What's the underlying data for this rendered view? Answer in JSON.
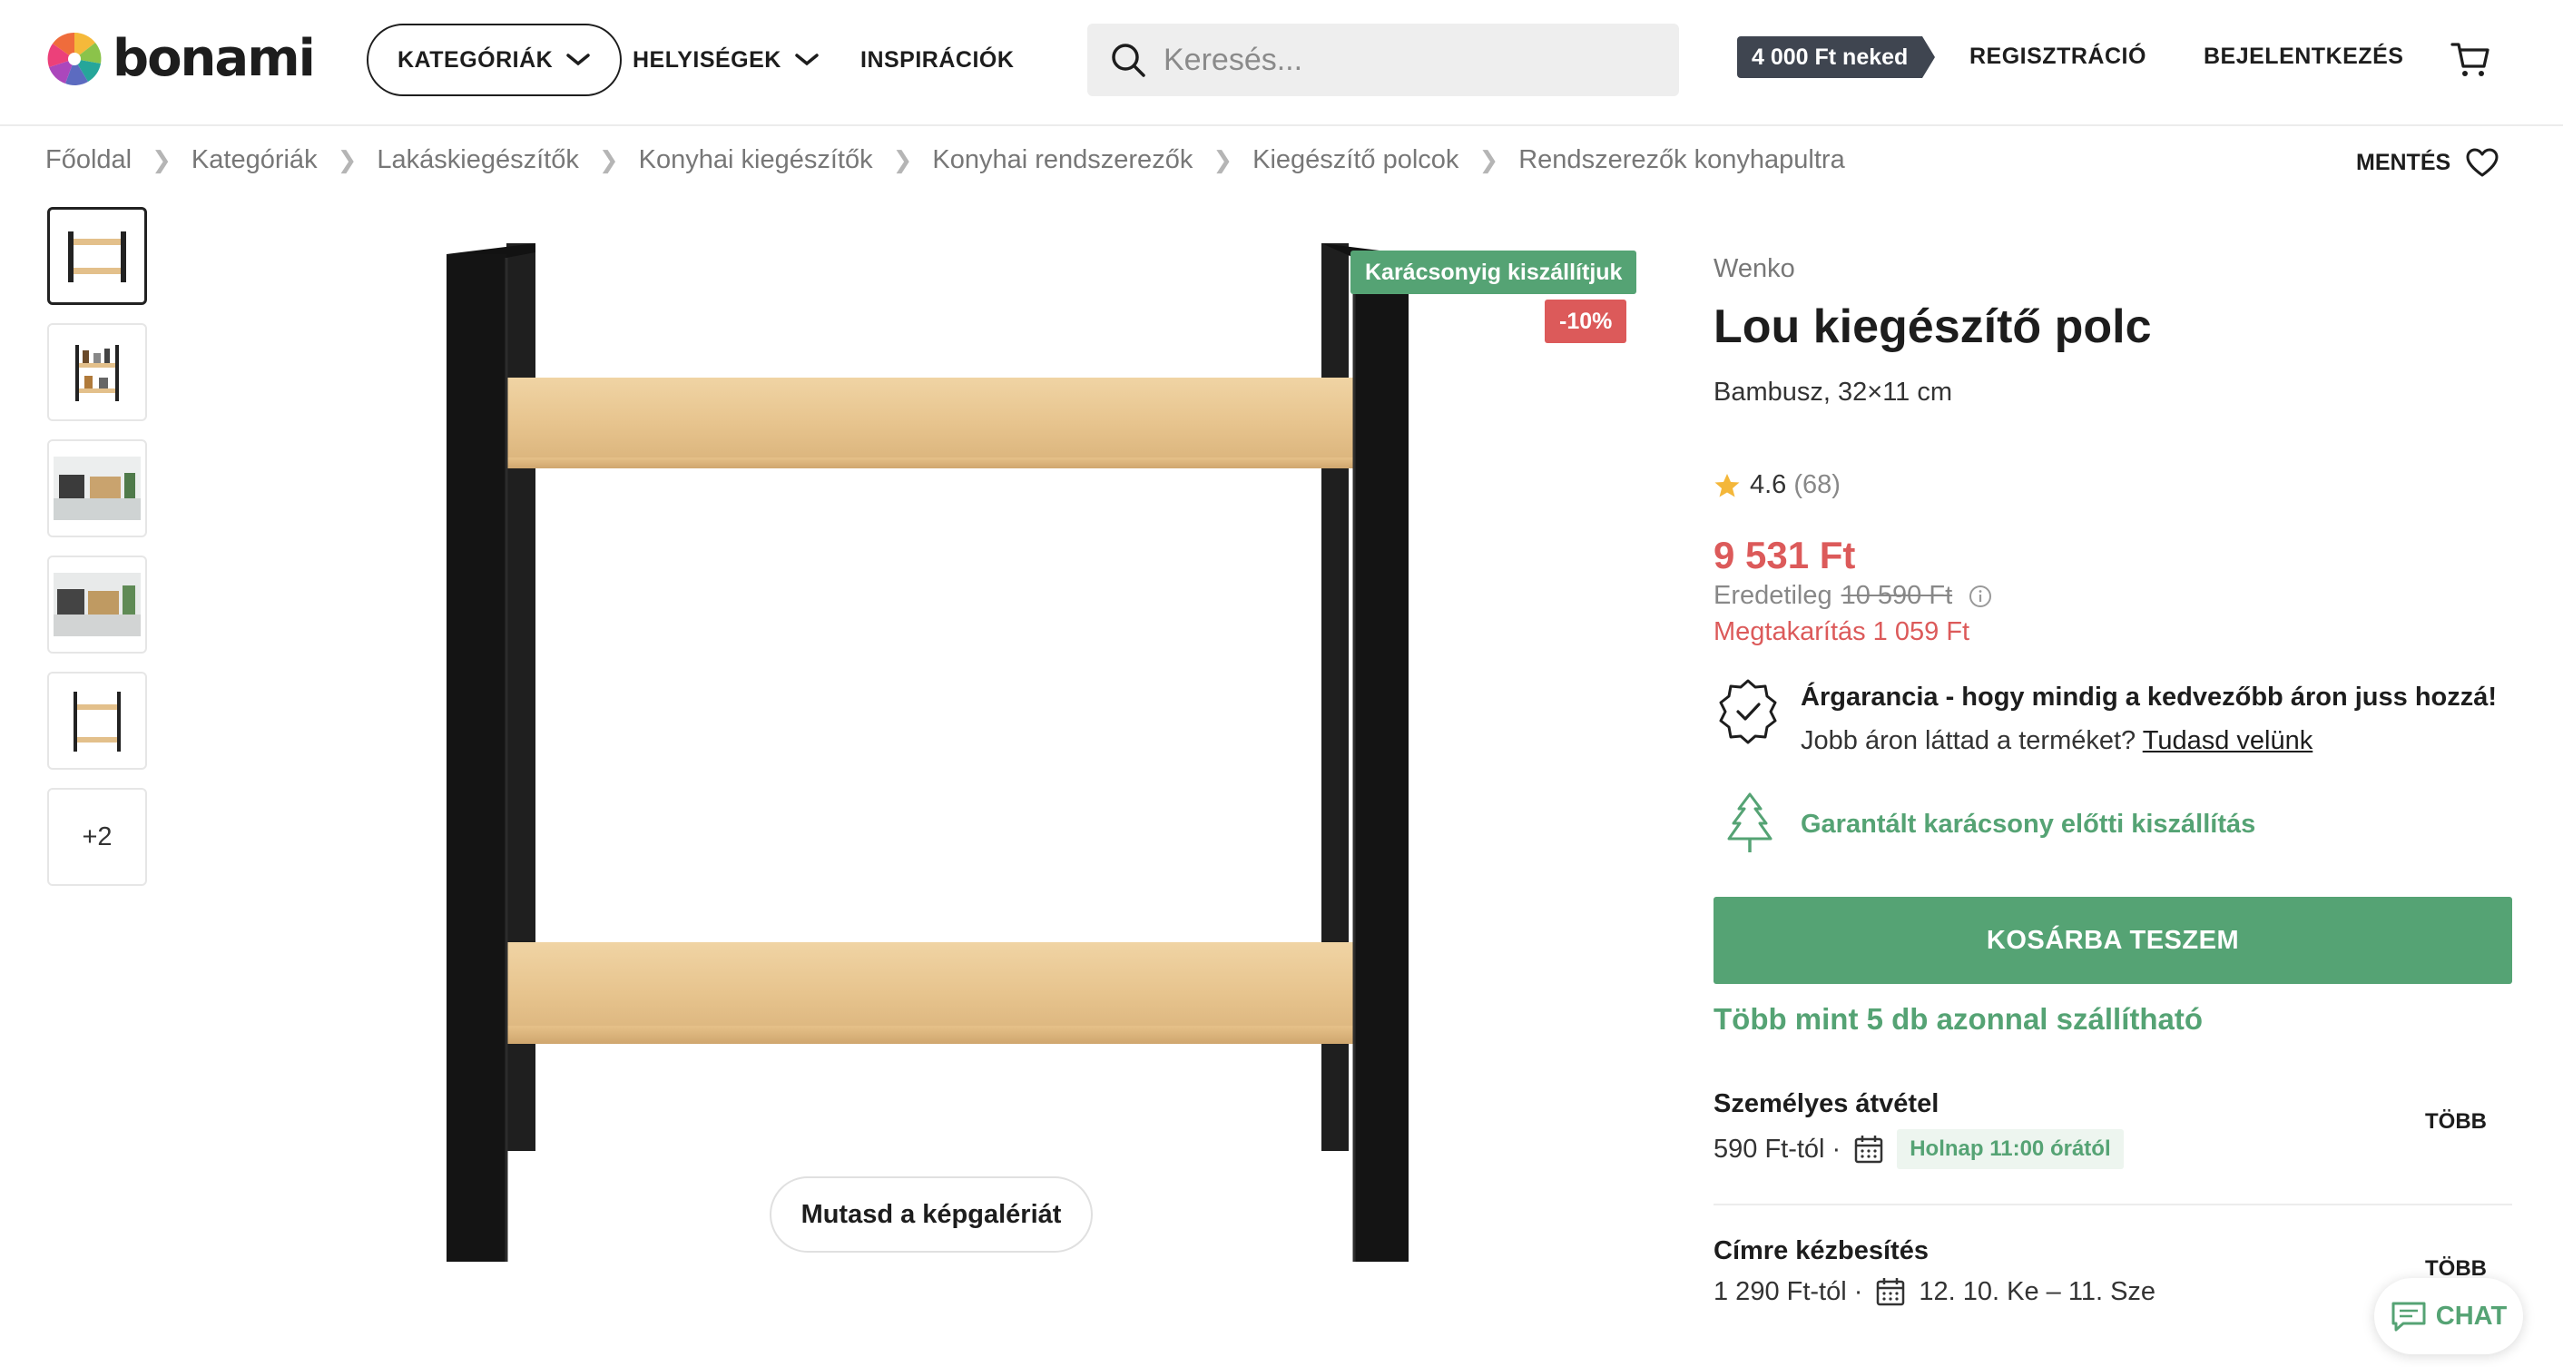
{
  "header": {
    "logo_text": "bonami",
    "nav": [
      {
        "label": "KATEGÓRIÁK"
      },
      {
        "label": "HELYISÉGEK"
      },
      {
        "label": "INSPIRÁCIÓK"
      }
    ],
    "search_placeholder": "Keresés...",
    "promo_badge": "4 000 Ft neked",
    "register": "REGISZTRÁCIÓ",
    "login": "BEJELENTKEZÉS"
  },
  "breadcrumb": [
    "Főoldal",
    "Kategóriák",
    "Lakáskiegészítők",
    "Konyhai kiegészítők",
    "Konyhai rendszerezők",
    "Kiegészítő polcok",
    "Rendszerezők konyhapultra"
  ],
  "save_label": "MENTÉS",
  "gallery": {
    "more_count": "+2",
    "badge_christmas": "Karácsonyig kiszállítjuk",
    "badge_discount": "-10%",
    "show_gallery": "Mutasd a képgalériát"
  },
  "product": {
    "brand": "Wenko",
    "title": "Lou kiegészítő polc",
    "subtitle": "Bambusz, 32×11 cm",
    "rating": "4.6",
    "rating_count": "(68)",
    "price": "9 531 Ft",
    "original_label": "Eredetileg",
    "original_price": "10 590 Ft",
    "savings": "Megtakarítás 1 059 Ft",
    "guarantee_title": "Árgarancia - hogy mindig a kedvezőbb áron juss hozzá!",
    "guarantee_text": "Jobb áron láttad a terméket?",
    "guarantee_link": "Tudasd velünk",
    "delivery_promise": "Garantált karácsony előtti kiszállítás",
    "add_to_cart": "KOSÁRBA TESZEM",
    "stock": "Több mint 5 db azonnal szállítható"
  },
  "shipping": [
    {
      "title": "Személyes átvétel",
      "price": "590 Ft-tól ·",
      "date": "Holnap 11:00 órától",
      "more": "TÖBB"
    },
    {
      "title": "Címre kézbesítés",
      "price": "1 290 Ft-tól ·",
      "date": "12. 10. Ke – 11. Sze",
      "more": "TÖBB"
    }
  ],
  "chat_label": "CHAT",
  "colors": {
    "green": "#55a374",
    "red": "#dc5a5a",
    "dark": "#1d1d1d"
  }
}
